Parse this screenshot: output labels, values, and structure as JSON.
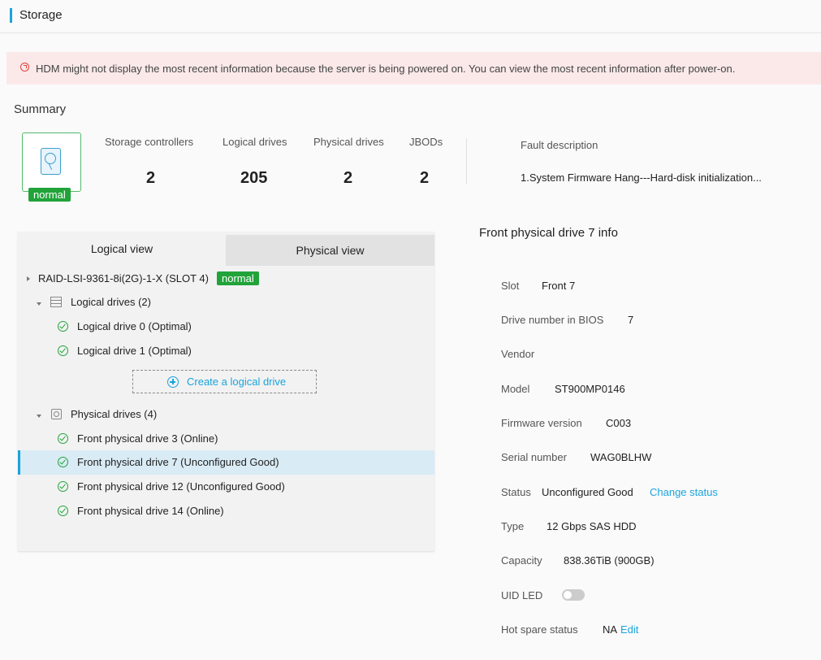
{
  "header": {
    "title": "Storage"
  },
  "alert": {
    "message": "HDM might not display the most recent information because the server is being powered on. You can view the most recent information after power-on.",
    "color": "#e0413a"
  },
  "summary": {
    "title": "Summary",
    "status_badge": "normal",
    "stats": [
      {
        "label": "Storage controllers",
        "value": "2"
      },
      {
        "label": "Logical drives",
        "value": "205"
      },
      {
        "label": "Physical drives",
        "value": "2"
      },
      {
        "label": "JBODs",
        "value": "2"
      }
    ],
    "fault_label": "Fault description",
    "fault_text": "1.System Firmware Hang---Hard-disk initialization..."
  },
  "tabs": {
    "logical": "Logical view",
    "physical": "Physical view"
  },
  "tree": {
    "controller": {
      "label": "RAID-LSI-9361-8i(2G)-1-X (SLOT 4)",
      "badge": "normal"
    },
    "logical_group": "Logical drives (2)",
    "logical_items": [
      "Logical drive 0 (Optimal)",
      "Logical drive 1 (Optimal)"
    ],
    "create_label": "Create a logical drive",
    "physical_group": "Physical drives (4)",
    "physical_items": [
      "Front physical drive 3 (Online)",
      "Front physical drive 7 (Unconfigured Good)",
      "Front physical drive 12 (Unconfigured Good)",
      "Front physical drive 14 (Online)"
    ]
  },
  "details": {
    "title": "Front physical drive 7 info",
    "slot_label": "Slot",
    "slot": "Front 7",
    "bios_label": "Drive number in BIOS",
    "bios": "7",
    "vendor_label": "Vendor",
    "vendor": "",
    "model_label": "Model",
    "model": "ST900MP0146",
    "firmware_label": "Firmware version",
    "firmware": "C003",
    "serial_label": "Serial number",
    "serial": "WAG0BLHW",
    "status_label": "Status",
    "status": "Unconfigured Good",
    "status_link": "Change status",
    "type_label": "Type",
    "type": "12 Gbps SAS HDD",
    "capacity_label": "Capacity",
    "capacity": "838.36TiB (900GB)",
    "uid_label": "UID LED",
    "uid_on": false,
    "hotspare_label": "Hot spare status",
    "hotspare": "NA",
    "hotspare_link": "Edit"
  },
  "colors": {
    "accent": "#1aa4dc",
    "ok": "#21a33a"
  }
}
